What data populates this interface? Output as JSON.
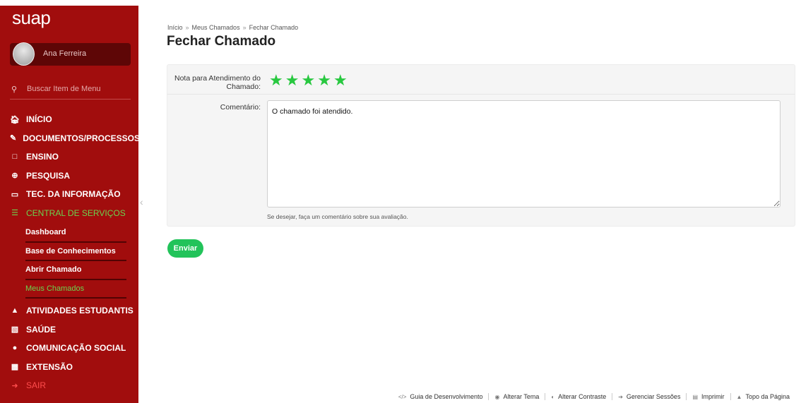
{
  "sidebar": {
    "logo": "suap",
    "user_name": "Ana Ferreira",
    "search_placeholder": "Buscar Item de Menu",
    "items": [
      {
        "label": "INÍCIO",
        "icon": "home-icon"
      },
      {
        "label": "DOCUMENTOS/PROCESSOS",
        "icon": "documents-icon"
      },
      {
        "label": "ENSINO",
        "icon": "teaching-icon"
      },
      {
        "label": "PESQUISA",
        "icon": "globe-icon"
      },
      {
        "label": "TEC. DA INFORMAÇÃO",
        "icon": "laptop-icon"
      },
      {
        "label": "CENTRAL DE SERVIÇOS",
        "icon": "list-icon",
        "active": true
      },
      {
        "label": "ATIVIDADES ESTUDANTIS",
        "icon": "graduation-icon"
      },
      {
        "label": "SAÚDE",
        "icon": "health-icon"
      },
      {
        "label": "COMUNICAÇÃO SOCIAL",
        "icon": "chat-icon"
      },
      {
        "label": "EXTENSÃO",
        "icon": "briefcase-icon"
      },
      {
        "label": "SAIR",
        "icon": "sign-out-icon"
      }
    ],
    "submenu": [
      {
        "label": "Dashboard"
      },
      {
        "label": "Base de Conhecimentos"
      },
      {
        "label": "Abrir Chamado"
      },
      {
        "label": "Meus Chamados",
        "active": true
      }
    ]
  },
  "breadcrumb": {
    "items": [
      "Início",
      "Meus Chamados",
      "Fechar Chamado"
    ],
    "separator": "»"
  },
  "page_title": "Fechar Chamado",
  "form": {
    "rating_label": "Nota para Atendimento do Chamado:",
    "rating_value": 5,
    "rating_max": 5,
    "comment_label": "Comentário:",
    "comment_value": "O chamado foi atendido.",
    "help_text": "Se desejar, faça um comentário sobre sua avaliação.",
    "submit_label": "Enviar"
  },
  "footer": {
    "links": [
      {
        "label": "Guia de Desenvolvimento",
        "icon": "code-icon"
      },
      {
        "label": "Alterar Tema",
        "icon": "palette-icon"
      },
      {
        "label": "Alterar Contraste",
        "icon": "contrast-icon"
      },
      {
        "label": "Gerenciar Sessões",
        "icon": "sign-in-icon"
      },
      {
        "label": "Imprimir",
        "icon": "print-icon"
      },
      {
        "label": "Topo da Página",
        "icon": "arrow-up-icon"
      }
    ]
  },
  "colors": {
    "sidebar_bg": "#a10d0d",
    "accent_green": "#28c840",
    "active_menu": "#6bd44f",
    "submit_bg": "#22c35a"
  }
}
